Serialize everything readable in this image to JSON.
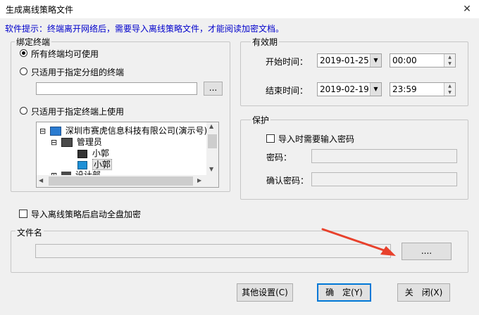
{
  "window": {
    "title": "生成离线策略文件",
    "close": "✕"
  },
  "tip": "软件提示：终端离开网络后，需要导入离线策略文件，才能阅读加密文档。",
  "bind_group": {
    "legend": "绑定终端",
    "options": [
      {
        "label": "所有终端均可使用",
        "selected": true
      },
      {
        "label": "只适用于指定分组的终端",
        "selected": false
      },
      {
        "label": "只适用于指定终端上使用",
        "selected": false
      }
    ],
    "group_path": "",
    "browse_label": "...",
    "tree": [
      {
        "label": "深圳市赛虎信息科技有限公司(演示号)",
        "level": 0,
        "expander": "⊟"
      },
      {
        "label": "管理员",
        "level": 1,
        "expander": "⊟"
      },
      {
        "label": "小郭",
        "level": 2
      },
      {
        "label": "小郭",
        "level": 2,
        "selected": true
      },
      {
        "label": "设计部",
        "level": 1,
        "expander": "⊞"
      }
    ]
  },
  "validity": {
    "legend": "有效期",
    "start_label": "开始时间：",
    "start_date": "2019-01-25",
    "start_time": "00:00",
    "end_label": "结束时间：",
    "end_date": "2019-02-19",
    "end_time": "23:59"
  },
  "protect": {
    "legend": "保护",
    "need_password_label": "导入时需要输入密码",
    "password_label": "密码：",
    "confirm_label": "确认密码：",
    "password": "",
    "confirm": ""
  },
  "full_encrypt_label": "导入离线策略后启动全盘加密",
  "file_group": {
    "legend": "文件名",
    "path": "",
    "browse_label": "...."
  },
  "buttons": {
    "other": "其他设置(C)",
    "ok": "确　定(Y)",
    "close": "关　闭(X)"
  },
  "colors": {
    "tip": "#0000cc",
    "accent": "#0078d7",
    "arrow": "#e8412c"
  }
}
